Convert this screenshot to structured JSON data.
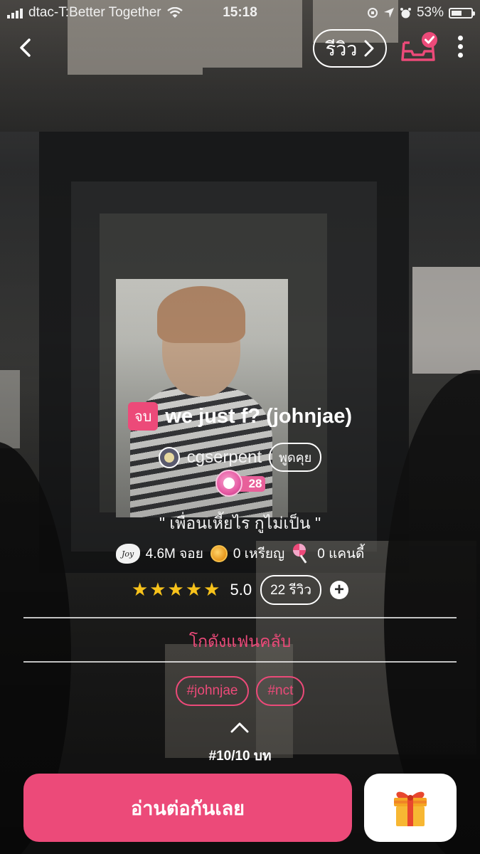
{
  "status_bar": {
    "carrier": "dtac-T:Better Together",
    "time": "15:18",
    "battery": "53%"
  },
  "header": {
    "review_label": "รีวิว"
  },
  "story": {
    "status_badge": "จบ",
    "title": "we just f? (johnjae)",
    "author": "cgserpent",
    "chat_label": "พูดคุย",
    "level_count": "28",
    "quote": "\" เพื่อนเหี้ยไร กูไม่เป็น \"",
    "stats": {
      "joy_icon_text": "Joy",
      "joy": "4.6M จอย",
      "coins": "0 เหรียญ",
      "candy": "0 แคนดี้"
    },
    "rating": {
      "stars": "★★★★★",
      "value": "5.0",
      "reviews": "22 รีวิว",
      "add_symbol": "+"
    },
    "fanclub_label": "โกดังแฟนคลับ",
    "tags": [
      "#johnjae",
      "#nct"
    ],
    "chapter": "#10/10 บท"
  },
  "actions": {
    "read_label": "อ่านต่อกันเลย"
  },
  "colors": {
    "accent": "#ec4a79",
    "star": "#f7c21b"
  },
  "icons": [
    "back-icon",
    "review-chevron-icon",
    "inbox-check-icon",
    "more-icon",
    "joy-icon",
    "coin-icon",
    "candy-icon",
    "plus-icon",
    "chevron-up-icon",
    "gift-icon"
  ]
}
